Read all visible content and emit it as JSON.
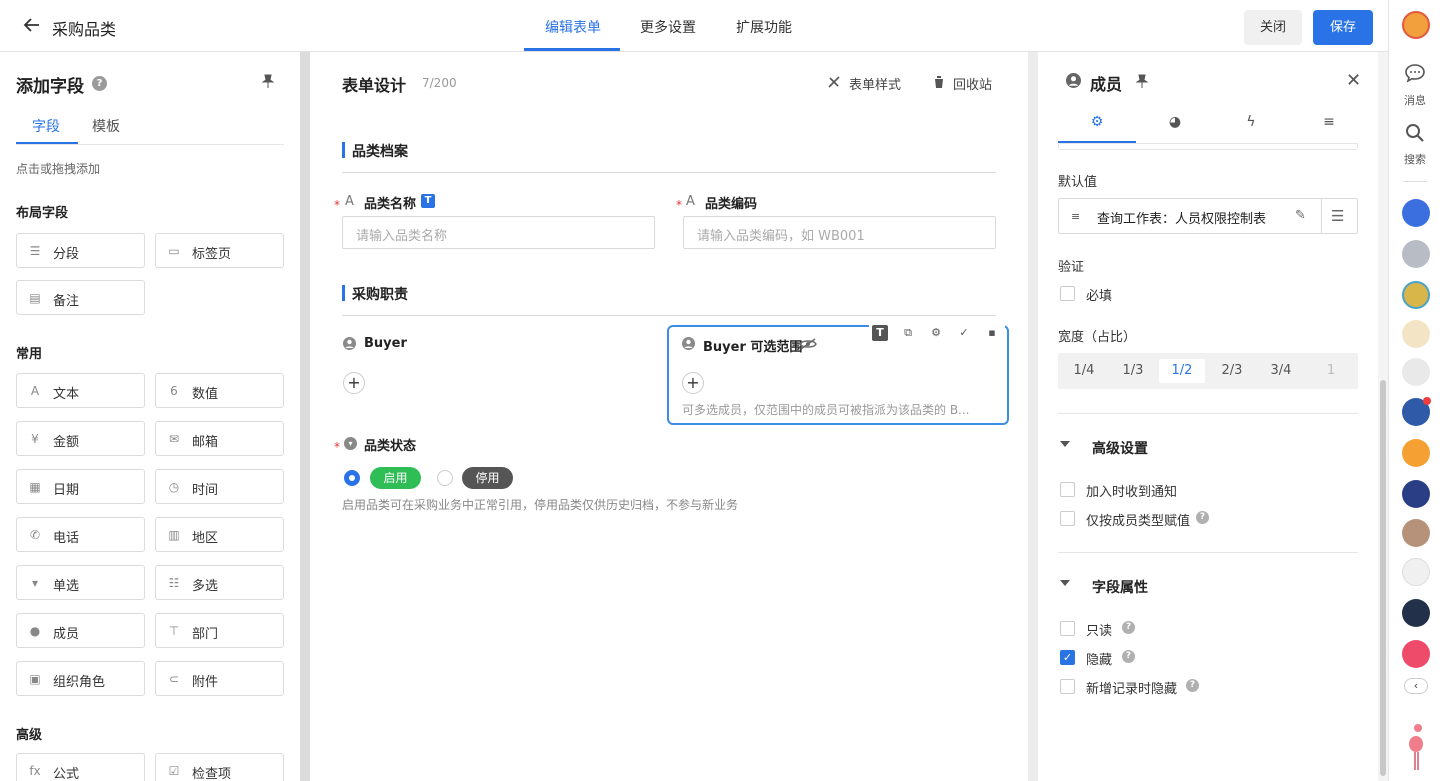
{
  "header": {
    "title": "采购品类",
    "tabs": [
      "编辑表单",
      "更多设置",
      "扩展功能"
    ],
    "close_label": "关闭",
    "save_label": "保存"
  },
  "dock": {
    "messages_label": "消息",
    "search_label": "搜索"
  },
  "left_panel": {
    "title": "添加字段",
    "tabs": [
      "字段",
      "模板"
    ],
    "hint": "点击或拖拽添加",
    "sections": {
      "layout": "布局字段",
      "common": "常用",
      "advanced": "高级"
    },
    "layout_fields": [
      "分段",
      "标签页",
      "备注"
    ],
    "common_fields": [
      "文本",
      "数值",
      "金额",
      "邮箱",
      "日期",
      "时间",
      "电话",
      "地区",
      "单选",
      "多选",
      "成员",
      "部门",
      "组织角色",
      "附件"
    ],
    "advanced_fields": [
      "公式",
      "检查项"
    ]
  },
  "form": {
    "title": "表单设计",
    "count": "7/200",
    "style_label": "表单样式",
    "recycle_label": "回收站",
    "section1": "品类档案",
    "name_label": "品类名称",
    "name_placeholder": "请输入品类名称",
    "code_label": "品类编码",
    "code_placeholder": "请输入品类编码，如 WB001",
    "section2": "采购职责",
    "buyer_label": "Buyer",
    "buyer_range_label": "Buyer 可选范围",
    "buyer_range_hint": "可多选成员，仅范围中的成员可被指派为该品类的 B...",
    "status_label": "品类状态",
    "status_options": [
      "启用",
      "停用"
    ],
    "status_hint": "启用品类可在采购业务中正常引用，停用品类仅供历史归档，不参与新业务"
  },
  "right_panel": {
    "title": "成员",
    "default_label": "默认值",
    "default_value": "查询工作表：人员权限控制表",
    "validation_label": "验证",
    "required_label": "必填",
    "width_label": "宽度（占比）",
    "width_options": [
      "1/4",
      "1/3",
      "1/2",
      "2/3",
      "3/4",
      "1"
    ],
    "width_selected": "1/2",
    "advanced_title": "高级设置",
    "notify_label": "加入时收到通知",
    "by_type_label": "仅按成员类型赋值",
    "field_props_title": "字段属性",
    "readonly_label": "只读",
    "hidden_label": "隐藏",
    "hide_on_new_label": "新增记录时隐藏"
  },
  "colors": {
    "accent": "#2a73e6",
    "enabled_tag": "#2fbd55",
    "disabled_tag": "#555555",
    "required_star": "#e53935"
  },
  "icons": [
    "back-arrow-icon",
    "help-icon",
    "pin-icon",
    "text-icon",
    "number-icon",
    "member-icon",
    "copy-icon",
    "gear-icon",
    "check-icon",
    "trash-icon",
    "eye-off-icon",
    "palette-icon",
    "lightning-icon",
    "sort-icon",
    "close-icon",
    "edit-icon",
    "list-add-icon",
    "chat-icon",
    "search-icon"
  ]
}
